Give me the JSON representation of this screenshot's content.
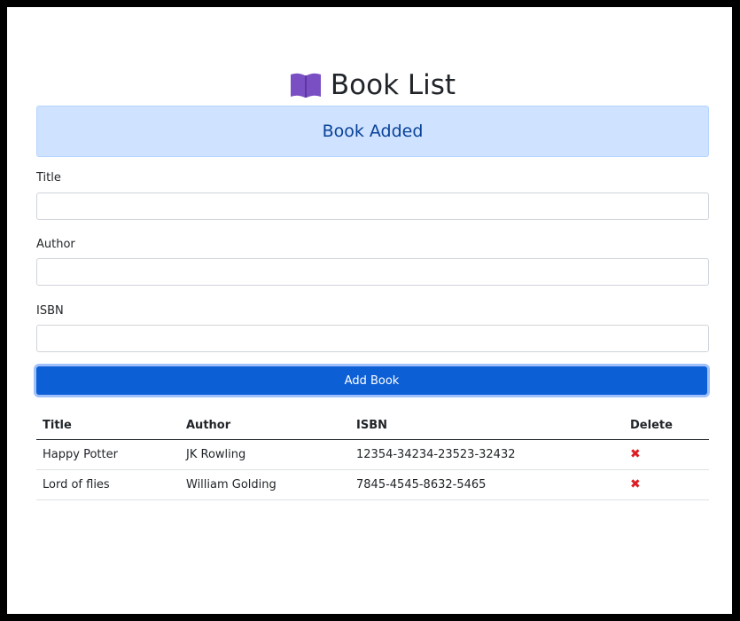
{
  "header": {
    "title": "Book List",
    "icon": "book-open-icon",
    "icon_color": "#7a4fc4"
  },
  "alert": {
    "message": "Book Added",
    "bg": "#cfe2ff",
    "text_color": "#084298"
  },
  "form": {
    "title_label": "Title",
    "title_value": "",
    "author_label": "Author",
    "author_value": "",
    "isbn_label": "ISBN",
    "isbn_value": "",
    "submit_label": "Add Book",
    "submit_color": "#0d5fd6"
  },
  "table": {
    "headers": [
      "Title",
      "Author",
      "ISBN",
      "Delete"
    ],
    "rows": [
      {
        "title": "Happy Potter",
        "author": "JK Rowling",
        "isbn": "12354-34234-23523-32432",
        "delete": "✖"
      },
      {
        "title": "Lord of flies",
        "author": "William Golding",
        "isbn": "7845-4545-8632-5465",
        "delete": "✖"
      }
    ],
    "delete_color": "#dc1f26"
  }
}
